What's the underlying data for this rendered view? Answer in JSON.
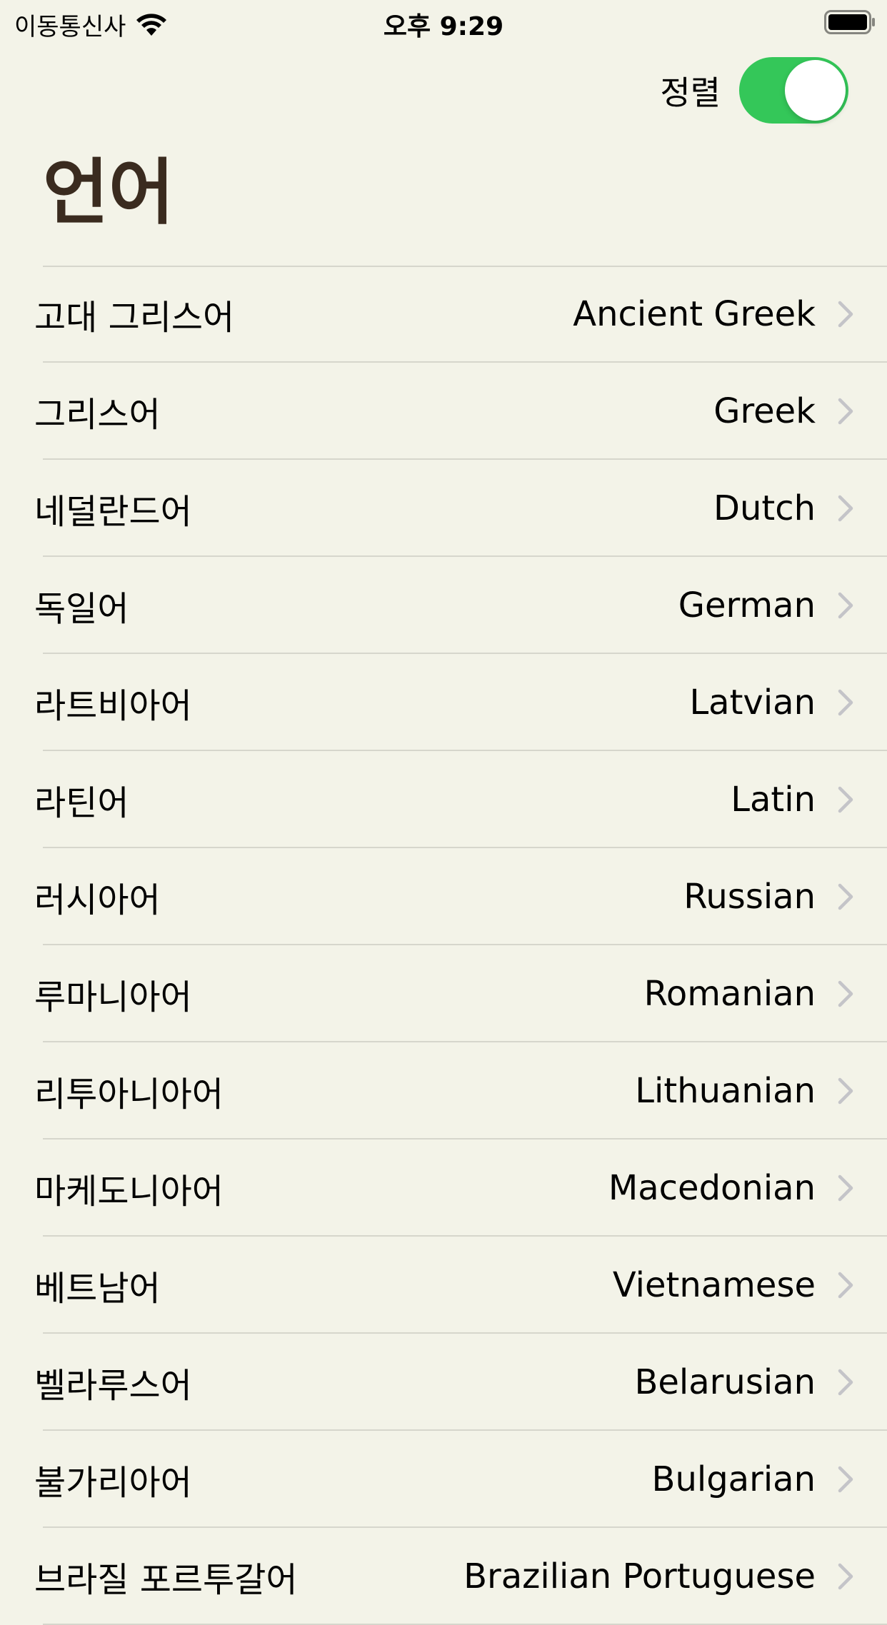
{
  "status_bar": {
    "carrier": "이동통신사",
    "time": "오후 9:29"
  },
  "nav": {
    "sort_label": "정렬",
    "sort_toggle_on": true,
    "accent": "#34c759"
  },
  "title": "언어",
  "languages": [
    {
      "label": "고대 그리스어",
      "detail": "Ancient Greek"
    },
    {
      "label": "그리스어",
      "detail": "Greek"
    },
    {
      "label": "네덜란드어",
      "detail": "Dutch"
    },
    {
      "label": "독일어",
      "detail": "German"
    },
    {
      "label": "라트비아어",
      "detail": "Latvian"
    },
    {
      "label": "라틴어",
      "detail": "Latin"
    },
    {
      "label": "러시아어",
      "detail": "Russian"
    },
    {
      "label": "루마니아어",
      "detail": "Romanian"
    },
    {
      "label": "리투아니아어",
      "detail": "Lithuanian"
    },
    {
      "label": "마케도니아어",
      "detail": "Macedonian"
    },
    {
      "label": "베트남어",
      "detail": "Vietnamese"
    },
    {
      "label": "벨라루스어",
      "detail": "Belarusian"
    },
    {
      "label": "불가리아어",
      "detail": "Bulgarian"
    },
    {
      "label": "브라질 포르투갈어",
      "detail": "Brazilian Portuguese"
    }
  ]
}
